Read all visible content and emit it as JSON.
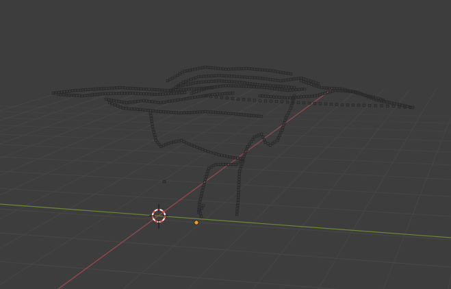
{
  "viewport": {
    "mode": "3d-viewport",
    "grid": "on",
    "axes": [
      "x",
      "y"
    ]
  },
  "colors": {
    "background": "#3d3d3d",
    "grid_line": "#4a4a4a",
    "x_axis": "#9b4a55",
    "y_axis": "#6b8a35",
    "point": "#2b2b2b",
    "origin": "#f29d28",
    "cursor_ring_a": "#ff4444",
    "cursor_ring_b": "#ffffff"
  },
  "icons": {
    "cursor": "3d-cursor-icon",
    "origin": "object-origin-icon"
  }
}
